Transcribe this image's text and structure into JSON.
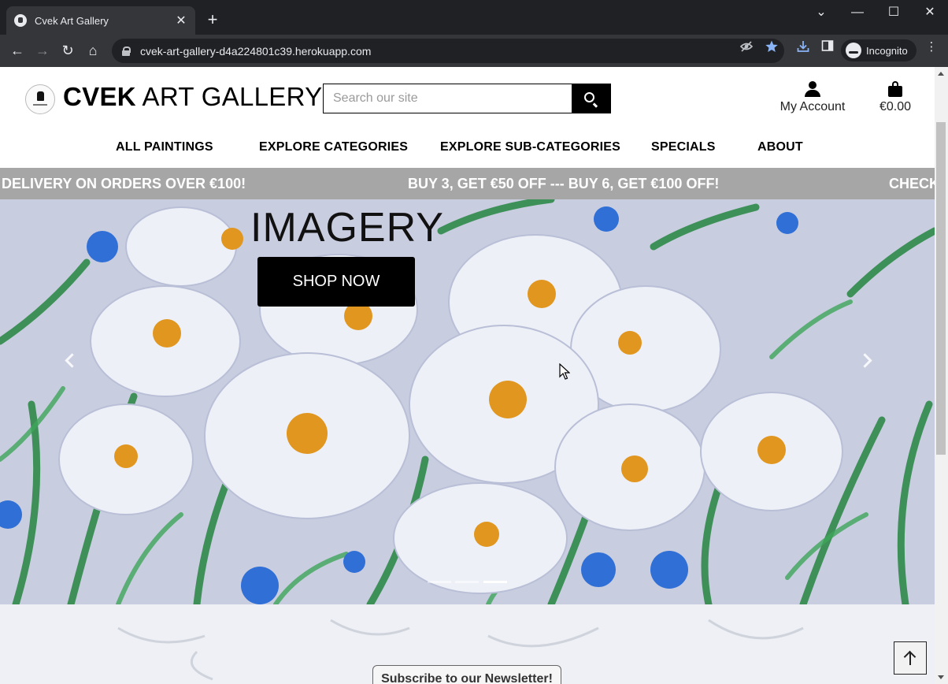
{
  "browser": {
    "tab_title": "Cvek Art Gallery",
    "tab_close": "✕",
    "new_tab": "+",
    "url": "cvek-art-gallery-d4a224801c39.herokuapp.com",
    "profile_label": "Incognito",
    "window_controls": {
      "dropdown": "⌄",
      "minimize": "—",
      "maximize": "☐",
      "close": "✕"
    },
    "nav": {
      "back": "←",
      "forward": "→",
      "reload": "↻",
      "home": "⌂"
    },
    "icons": {
      "eye_off": "eye-off-icon",
      "bookmark_star": "star-icon",
      "download": "download-icon",
      "side_panel": "side-panel-icon",
      "menu": "⋮"
    }
  },
  "header": {
    "brand_bold": "CVEK",
    "brand_rest": "ART GALLERY",
    "search_placeholder": "Search our site",
    "account_label": "My Account",
    "cart_total": "€0.00"
  },
  "nav": {
    "items": [
      "ALL PAINTINGS",
      "EXPLORE CATEGORIES",
      "EXPLORE SUB-CATEGORIES",
      "SPECIALS",
      "ABOUT"
    ]
  },
  "banner": {
    "messages": [
      "DELIVERY ON ORDERS OVER €100!",
      "BUY 3, GET €50 OFF --- BUY 6, GET €100 OFF!",
      "CHECK"
    ]
  },
  "hero": {
    "title": "IMAGERY",
    "cta": "SHOP NOW",
    "slide_count": 3,
    "active_slide": 3
  },
  "newsletter": {
    "label": "Subscribe to our Newsletter!"
  },
  "colors": {
    "browser_bg": "#202124",
    "toolbar_bg": "#35363a",
    "banner_bg": "#a6a6a6",
    "accent": "#000000",
    "bookmark_star": "#8ab4f8"
  }
}
